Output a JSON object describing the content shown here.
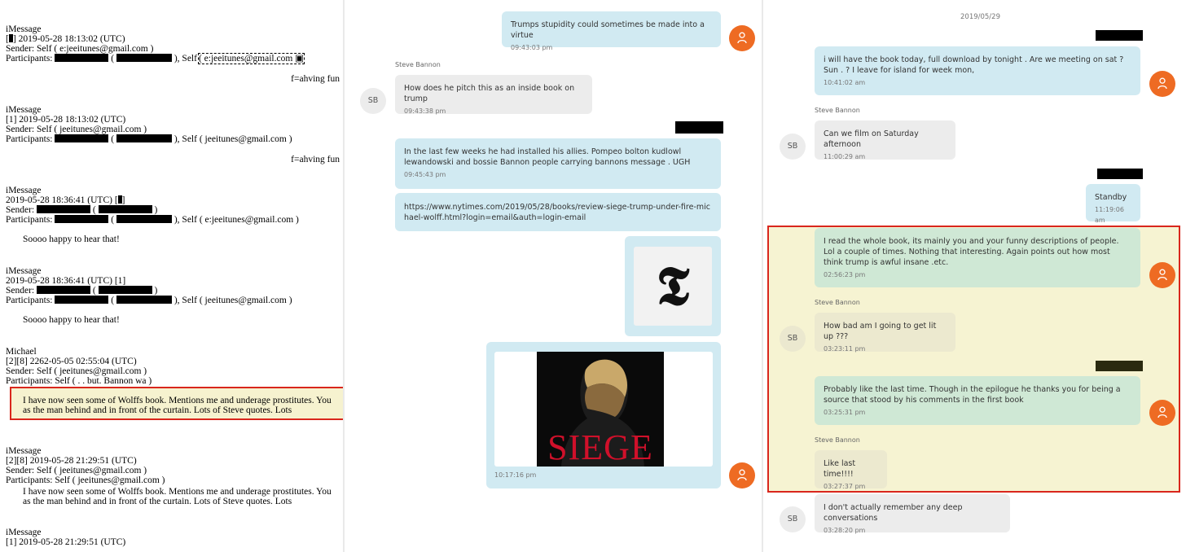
{
  "left_log": {
    "rec1": {
      "service": "iMessage",
      "time": "2019-05-28 18:13:02 (UTC)",
      "time_prefix": "[",
      "time_tag": "]",
      "sender": "Sender: Self ( e:jeeitunes@gmail.com )",
      "participants_prefix": "Participants:",
      "participants_sep": "(",
      "participants_self_prefix": "), Self",
      "participants_self": "( e:jeeitunes@gmail.com",
      "message": "f=ahving fun"
    },
    "rec2": {
      "service": "iMessage",
      "time": "[1] 2019-05-28 18:13:02 (UTC)",
      "sender": "Sender: Self ( jeeitunes@gmail.com )",
      "participants_prefix": "Participants:",
      "participants_sep": "(",
      "participants_tail": "), Self ( jeeitunes@gmail.com )",
      "message": "f=ahving fun"
    },
    "rec3": {
      "service": "iMessage",
      "time": "2019-05-28 18:36:41 (UTC) [",
      "time_tag": "]",
      "sender_prefix": "Sender:",
      "sender_sep": "(",
      "sender_close": ")",
      "participants_prefix": "Participants:",
      "participants_sep": "(",
      "participants_tail": "), Self ( e:jeeitunes@gmail.com )",
      "message": "Soooo happy to hear that!"
    },
    "rec4": {
      "service": "iMessage",
      "time": "2019-05-28 18:36:41 (UTC) [1]",
      "sender_prefix": "Sender:",
      "sender_sep": "(",
      "sender_close": ")",
      "participants_prefix": "Participants:",
      "participants_sep": "(",
      "participants_tail": "), Self ( jeeitunes@gmail.com )",
      "message": "Soooo happy to hear that!"
    },
    "rec5": {
      "service": "Michael",
      "time": "[2][8] 2262-05-05 02:55:04 (UTC)",
      "sender": "Sender: Self ( jeeitunes@gmail.com )",
      "participants": "Participants: Self ( . . but.  Bannon wa )",
      "message": "I have now seen some of Wolffs book.   Mentions me and underage prostitutes.  You as the man behind and in front of the curtain.  Lots of Steve quotes. Lots"
    },
    "rec6": {
      "service": "iMessage",
      "time": "[2][8] 2019-05-28 21:29:51 (UTC)",
      "sender": "Sender: Self ( jeeitunes@gmail.com )",
      "participants": "Participants: Self ( jeeitunes@gmail.com )",
      "message": "I have now seen some of Wolffs book.   Mentions me and underage prostitutes.  You as the man behind and in front of the curtain.  Lots of Steve quotes. Lots"
    },
    "rec7": {
      "service": "iMessage",
      "time": "[1] 2019-05-28 21:29:51 (UTC)"
    }
  },
  "mid_chat": {
    "m1": {
      "text": "Trumps stupidity could sometimes be made into a virtue",
      "time": "09:43:03 pm"
    },
    "sender1": "Steve Bannon",
    "m2": {
      "text": "How does he pitch this as an inside book on trump",
      "time": "09:43:38 pm"
    },
    "m3": {
      "text": "In the last few weeks he had installed his allies. Pompeo bolton kudlowl  lewandowski and bossie   Bannon people carrying bannons message  .  UGH",
      "time": "09:45:43 pm"
    },
    "m4": {
      "text": "https://www.nytimes.com/2019/05/28/books/review-siege-trump-under-fire-michael-wolff.html?login=email&auth=login-email"
    },
    "m5": {
      "word": "SIEGE",
      "time": "10:17:16 pm"
    },
    "avatar_initials": "SB",
    "nyt_glyph": "𝕿"
  },
  "right_chat": {
    "date": "2019/05/29",
    "r1": {
      "text": "i will have the book today,    full download by tonight  .  Are we meeting on sat ? Sun .  ?  I leave for island for week mon,",
      "time": "10:41:02 am"
    },
    "sender_a": "Steve Bannon",
    "r2": {
      "text": "Can we film on Saturday afternoon",
      "time": "11:00:29 am"
    },
    "r3": {
      "text": "Standby",
      "time": "11:19:06 am"
    },
    "r4": {
      "text": "I read the whole book,   its mainly you and your funny descriptions of people.   Lol a couple of times.  Nothing that interesting.   Again points out how most think trump is awful insane .etc.",
      "time": "02:56:23 pm"
    },
    "sender_b": "Steve Bannon",
    "r5": {
      "text": "How bad am I going to get lit up ???",
      "time": "03:23:11 pm"
    },
    "r6": {
      "text": "Probably like the last time.    Though in the epilogue he thanks you for being a source that stood by his  comments in the first book",
      "time": "03:25:31 pm"
    },
    "sender_c": "Steve Bannon",
    "r7": {
      "text": "Like last time!!!!",
      "time": "03:27:37 pm"
    },
    "r8": {
      "text": "I don't actually remember any deep conversations",
      "time": "03:28:20 pm"
    },
    "avatar_initials": "SB"
  },
  "colors": {
    "outgoing_bubble": "#d1eaf2",
    "incoming_bubble": "#ececec",
    "avatar_me": "#ee6b23",
    "highlight_border": "#d9261c",
    "highlight_fill": "#f6f3d2"
  },
  "icons": {
    "self_avatar": "person-icon"
  }
}
